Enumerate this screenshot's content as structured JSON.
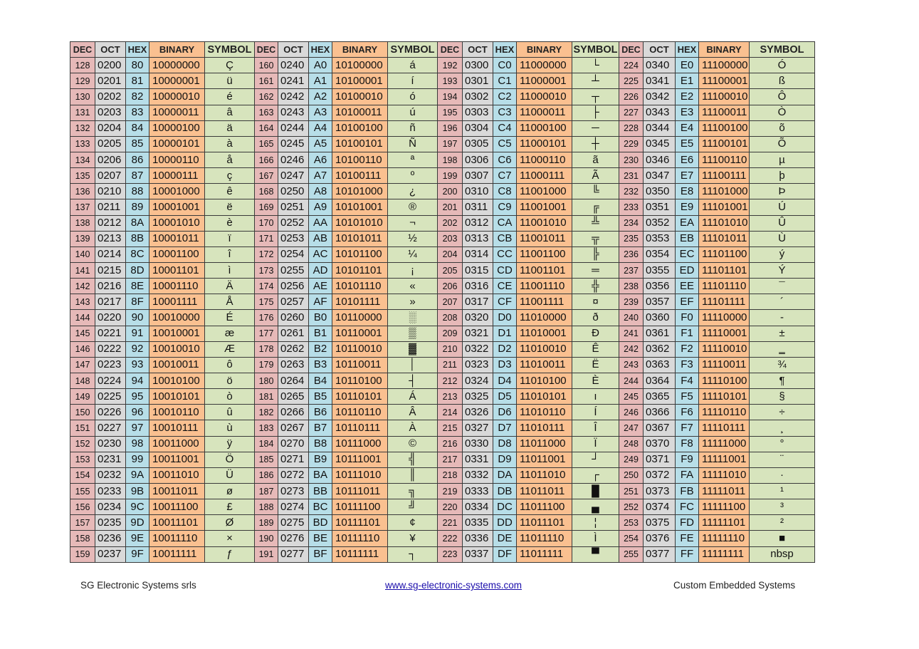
{
  "headers": [
    "DEC",
    "OCT",
    "HEX",
    "BINARY",
    "SYMBOL"
  ],
  "groups": [
    {
      "symbols": [
        "Ç",
        "ü",
        "é",
        "â",
        "ä",
        "à",
        "å",
        "ç",
        "ê",
        "ë",
        "è",
        "ï",
        "î",
        "ì",
        "Ä",
        "Å",
        "É",
        "æ",
        "Æ",
        "ô",
        "ö",
        "ò",
        "û",
        "ù",
        "ÿ",
        "Ö",
        "Ü",
        "ø",
        "£",
        "Ø",
        "×",
        "ƒ"
      ]
    },
    {
      "symbols": [
        "á",
        "í",
        "ó",
        "ú",
        "ñ",
        "Ñ",
        "ª",
        "º",
        "¿",
        "®",
        "¬",
        "½",
        "¼",
        "¡",
        "«",
        "»",
        "░",
        "▒",
        "▓",
        "│",
        "┤",
        "Á",
        "Â",
        "À",
        "©",
        "╣",
        "║",
        "╗",
        "╝",
        "¢",
        "¥",
        "┐"
      ]
    },
    {
      "symbols": [
        "└",
        "┴",
        "┬",
        "├",
        "─",
        "┼",
        "ã",
        "Ã",
        "╚",
        "╔",
        "╩",
        "╦",
        "╠",
        "═",
        "╬",
        "¤",
        "ð",
        "Ð",
        "Ê",
        "Ë",
        "È",
        "ı",
        "Í",
        "Î",
        "Ï",
        "┘",
        "┌",
        "█",
        "▄",
        "¦",
        "Ì",
        "▀"
      ]
    },
    {
      "symbols": [
        "Ó",
        "ß",
        "Ô",
        "Ò",
        "õ",
        "Õ",
        "µ",
        "þ",
        "Þ",
        "Ú",
        "Û",
        "Ù",
        "ý",
        "Ý",
        "¯",
        "´",
        "-",
        "±",
        "‗",
        "¾",
        "¶",
        "§",
        "÷",
        "¸",
        "°",
        "¨",
        "·",
        "¹",
        "³",
        "²",
        "■",
        "nbsp"
      ]
    }
  ],
  "footer": {
    "company": "SG Electronic Systems srls",
    "website": "www.sg-electronic-systems.com",
    "tagline": "Custom Embedded Systems"
  }
}
